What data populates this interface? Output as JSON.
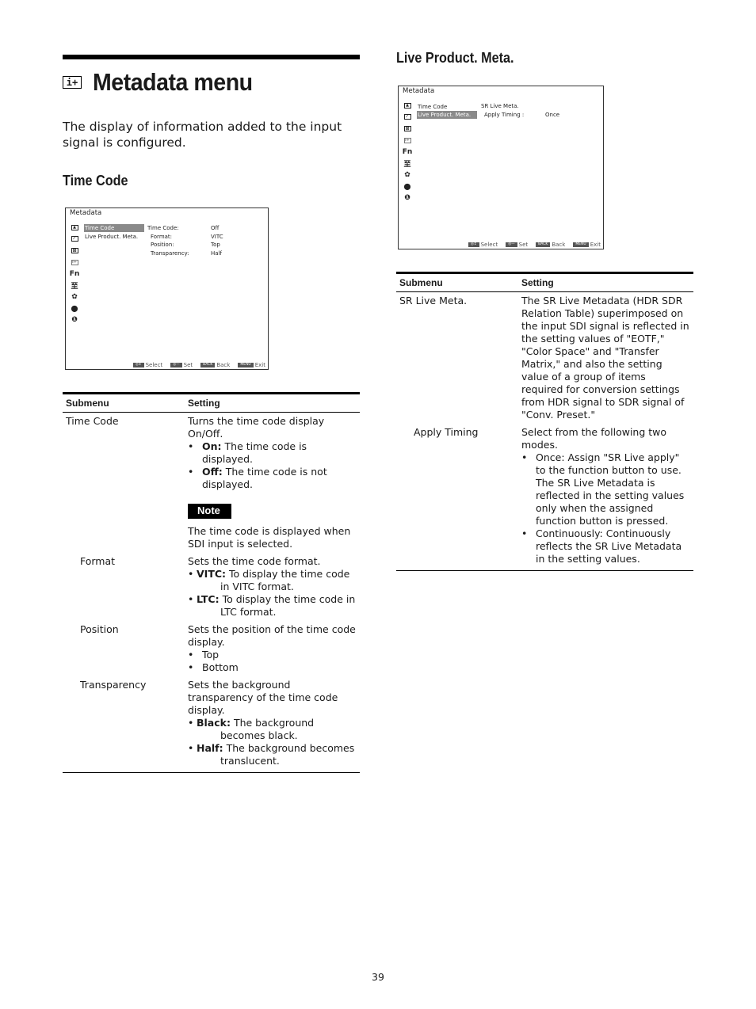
{
  "page": {
    "title": "Metadata menu",
    "title_icon": "i+",
    "intro": "The display of information added to the input signal is configured.",
    "page_number": "39"
  },
  "sections": {
    "time_code": {
      "heading": "Time Code",
      "screen": {
        "title": "Metadata",
        "menu_items": [
          {
            "label": "Time Code",
            "selected": true
          },
          {
            "label": "Live Product. Meta.",
            "selected": false
          }
        ],
        "settings": [
          {
            "label": "Time Code:",
            "value": "Off"
          },
          {
            "label": "Format:",
            "value": "VITC"
          },
          {
            "label": "Position:",
            "value": "Top"
          },
          {
            "label": "Transparency:",
            "value": "Half"
          }
        ]
      },
      "table": {
        "headers": [
          "Submenu",
          "Setting"
        ],
        "rows": {
          "time_code": {
            "submenu": "Time Code",
            "desc": "Turns the time code display On/Off.",
            "bullets": [
              {
                "term": "On:",
                "text": "The time code is displayed."
              },
              {
                "term": "Off:",
                "text": "The time code is not displayed."
              }
            ],
            "note_label": "Note",
            "note_text": "The time code is displayed when SDI input is selected."
          },
          "format": {
            "submenu": "Format",
            "desc": "Sets the time code format.",
            "bullets": [
              {
                "term": "VITC:",
                "text": "To display the time code in VITC format."
              },
              {
                "term": "LTC:",
                "text": "To display the time code in LTC format."
              }
            ]
          },
          "position": {
            "submenu": "Position",
            "desc": "Sets the position of the time code display.",
            "bullets": [
              "Top",
              "Bottom"
            ]
          },
          "transparency": {
            "submenu": "Transparency",
            "desc": "Sets the background transparency of the time code display.",
            "bullets": [
              {
                "term": "Black:",
                "text": "The background becomes black."
              },
              {
                "term": "Half:",
                "text": "The background becomes translucent."
              }
            ]
          }
        }
      }
    },
    "live_product": {
      "heading": "Live Product. Meta.",
      "screen": {
        "title": "Metadata",
        "menu_items": [
          {
            "label": "Time Code",
            "selected": false
          },
          {
            "label": "Live Product. Meta.",
            "selected": true
          }
        ],
        "settings": [
          {
            "label": "SR Live Meta.",
            "value": ""
          },
          {
            "label": "Apply Timing :",
            "value": "Once"
          }
        ]
      },
      "table": {
        "headers": [
          "Submenu",
          "Setting"
        ],
        "rows": {
          "sr_live": {
            "submenu": "SR Live Meta.",
            "desc": "The SR Live Metadata (HDR SDR Relation Table) superimposed on the input SDI signal is reflected in the setting values of \"EOTF,\" \"Color Space\" and \"Transfer Matrix,\" and also the setting value of a group of items required for conversion settings from HDR signal to SDR signal of \"Conv. Preset.\""
          },
          "apply_timing": {
            "submenu": "Apply Timing",
            "desc": "Select from the following two modes.",
            "bullets": [
              "Once: Assign \"SR Live apply\" to the function button to use. The SR Live Metadata is reflected in the setting values only when the assigned function button is pressed.",
              "Continuously: Continuously reflects the SR Live Metadata in the setting values."
            ]
          }
        }
      }
    }
  },
  "screen_footer": {
    "select_key": "◎↕",
    "select_label": "Select",
    "set_key": "◎—",
    "set_label": "Set",
    "back_key": "BACK",
    "back_label": "Back",
    "menu_key": "MENU",
    "exit_label": "Exit"
  },
  "screen_icons": [
    "picture-icon",
    "graph-icon",
    "grid-icon",
    "metadata-icon",
    "fn-icon",
    "layout-icon",
    "gear-icon",
    "wrench-icon",
    "info-icon"
  ],
  "screen_icon_glyphs": {
    "fn": "Fn",
    "layout": "至",
    "gear": "✿",
    "wrench": "⬤",
    "info": "❶"
  }
}
